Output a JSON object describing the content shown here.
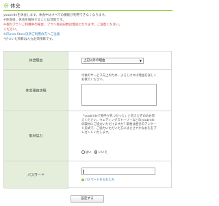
{
  "header": {
    "title": "休会",
    "icon": "gear-icon",
    "accent": "#8cc63f"
  },
  "notes": [
    {
      "text": "youbrideを休会します。休会中はすべての機能が利用できなくなります。",
      "style": "gray"
    },
    {
      "text": "※休会後、休会を解除することは可能です。",
      "style": "gray"
    },
    {
      "text": "※有料プランご利用中の場合、プラン有効日数は無効となります。ご注意ください。",
      "style": "red"
    },
    {
      "text": "ください。",
      "style": "red"
    },
    {
      "text": "※iTunes Store決済ご利用の方へご注意",
      "style": "link"
    },
    {
      "text": "*がついた項目は入力必須項目です。",
      "style": "gray"
    }
  ],
  "form": {
    "reason": {
      "label": "休会理由",
      "required": "*",
      "value": "上記以外の理由"
    },
    "detail": {
      "label": "休会理由詳細",
      "description": "今後のサービス向上のため、よろしければ理由を詳しくお教えください。"
    },
    "cooperation": {
      "label": "取材協力",
      "description": "「youbrideで相手が見つかった」と答えた方のみお答えください。ウェディングストーリーなどのyoubrideの取材にご協力いただけますか？取材は匿名のアンケート形式で、ご協力いただいた方にはささやかなお礼をプレゼントいたします。",
      "option_yes": "はい",
      "option_no": "いいえ",
      "selected": "いいえ"
    },
    "password": {
      "label": "パスワード",
      "required": "*",
      "value": "",
      "forgot_link": "パスワードを忘れた方"
    }
  },
  "confirm_button": "設定する"
}
